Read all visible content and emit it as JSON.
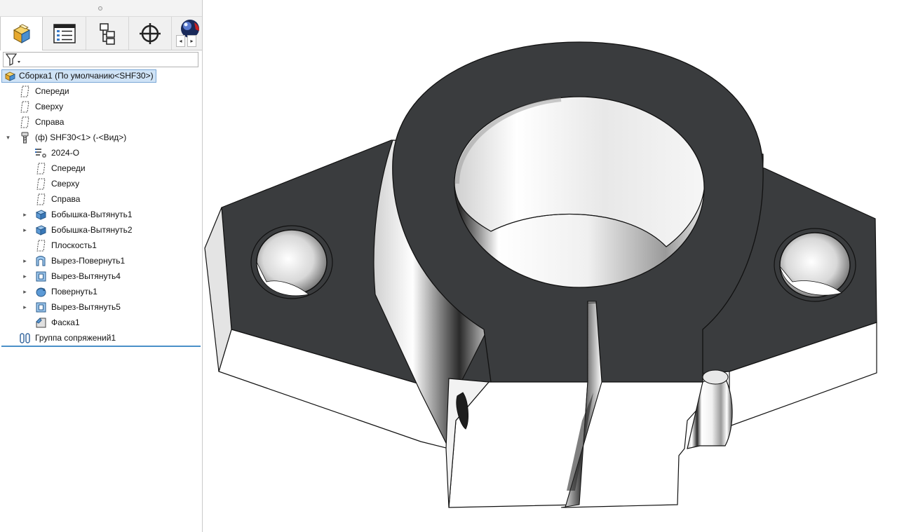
{
  "tabs": [
    {
      "name": "featuremanager",
      "icon": "featuremanager-icon"
    },
    {
      "name": "propertymanager",
      "icon": "propertymanager-icon"
    },
    {
      "name": "configurationmanager",
      "icon": "configurationmanager-icon"
    },
    {
      "name": "dimxpertmanager",
      "icon": "dimxpert-icon"
    },
    {
      "name": "displaymanager",
      "icon": "displaymanager-icon"
    }
  ],
  "filter": {
    "icon": "filter-icon"
  },
  "tree": {
    "root": "Сборка1  (По умолчанию<SHF30>)",
    "plane_front": "Спереди",
    "plane_top": "Сверху",
    "plane_right": "Справа",
    "component": "(ф) SHF30<1> (-<Вид>)",
    "material": "2024-O",
    "sub_front": "Спереди",
    "sub_top": "Сверху",
    "sub_right": "Справа",
    "boss1": "Бобышка-Вытянуть1",
    "boss2": "Бобышка-Вытянуть2",
    "plane1": "Плоскость1",
    "revcut1": "Вырез-Повернуть1",
    "cut4": "Вырез-Вытянуть4",
    "revolve1": "Повернуть1",
    "cut5": "Вырез-Вытянуть5",
    "chamfer1": "Фаска1",
    "mates": "Группа сопряжений1"
  },
  "colors": {
    "selection_bg": "#cfe3f6",
    "accent_blue": "#4a90c8",
    "part_dark_face": "#3a3c3e",
    "part_light_face": "#ffffff"
  }
}
